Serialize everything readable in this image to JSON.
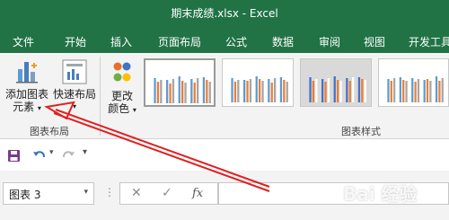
{
  "window": {
    "title": "期末成绩.xlsx  -  Excel"
  },
  "tabs": [
    "文件",
    "开始",
    "插入",
    "页面布局",
    "公式",
    "数据",
    "审阅",
    "视图",
    "开发工具"
  ],
  "ribbon": {
    "add_chart_element": {
      "line1": "添加图表",
      "line2": "元素"
    },
    "quick_layout": {
      "line1": "快速布局"
    },
    "change_colors": {
      "line1": "更改",
      "line2": "颜色"
    },
    "group_chart_layouts": "图表布局",
    "group_chart_styles": "图表样式"
  },
  "namebox": {
    "value": "图表 3"
  },
  "formula": {
    "fx_label": "fx",
    "value": ""
  },
  "watermark": {
    "text": "Bai 经验"
  },
  "colors": {
    "excel_green": "#217346",
    "arrow_red": "#e02020",
    "ribbon_bg": "#f3f3f3"
  }
}
